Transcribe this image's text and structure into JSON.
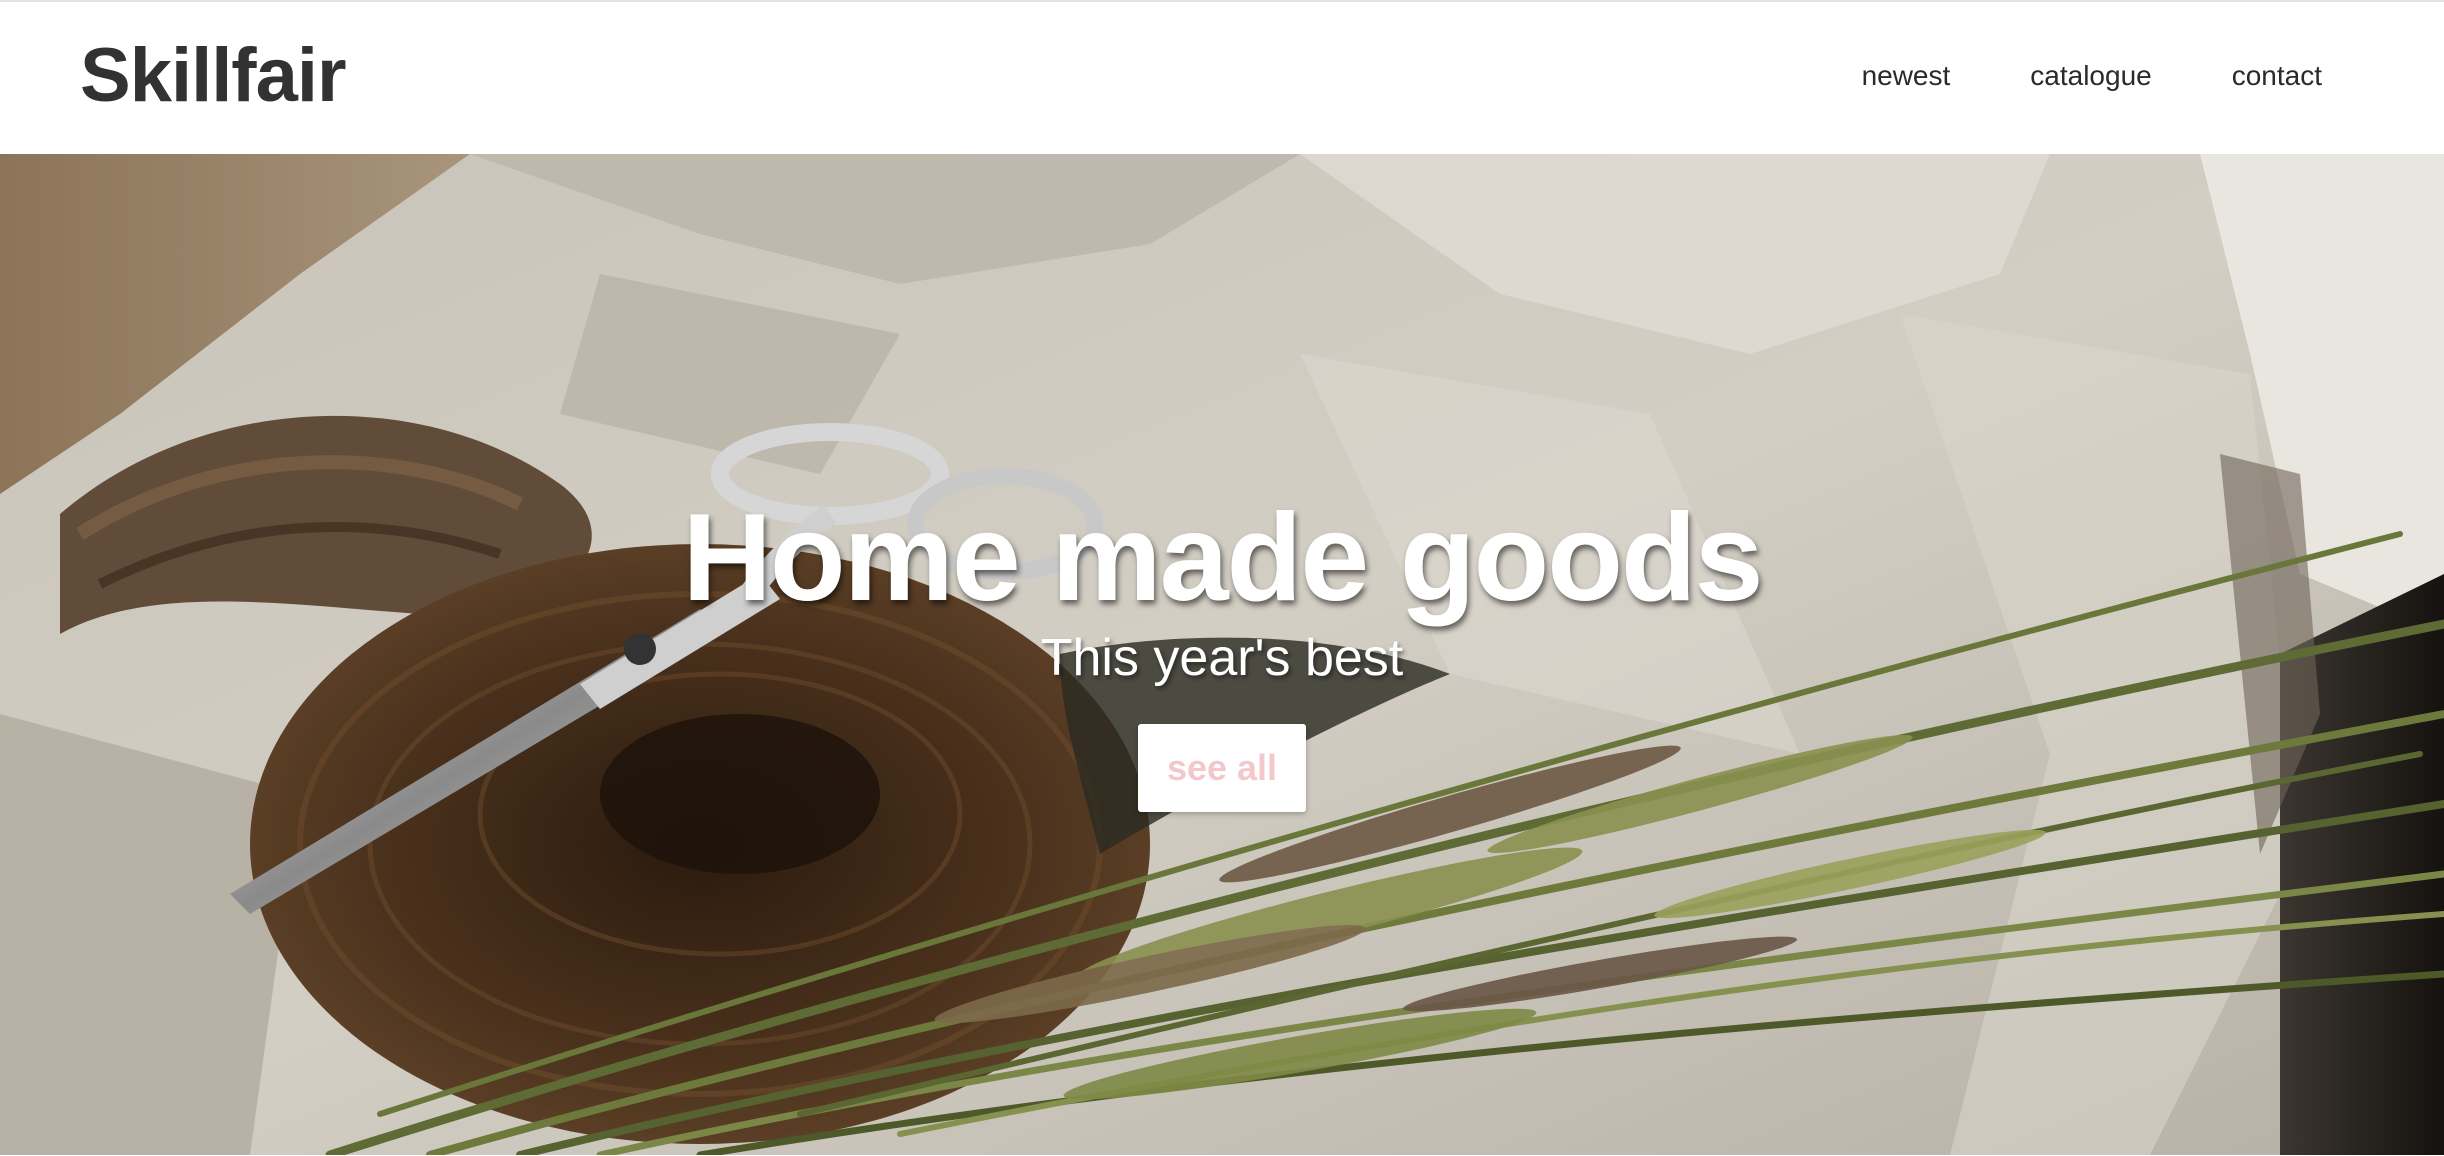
{
  "header": {
    "logo": "Skillfair",
    "nav": [
      "newest",
      "catalogue",
      "contact"
    ]
  },
  "hero": {
    "title": "Home made goods",
    "subtitle": "This year's best",
    "button_label": "see all",
    "image_description_icon": "craft-photo-scissors-twine-wheat"
  },
  "colors": {
    "logo": "#323232",
    "nav_text": "#2a2a2a",
    "button_bg": "#ffffff",
    "button_text": "#f4c7cc",
    "hero_text": "#ffffff"
  }
}
